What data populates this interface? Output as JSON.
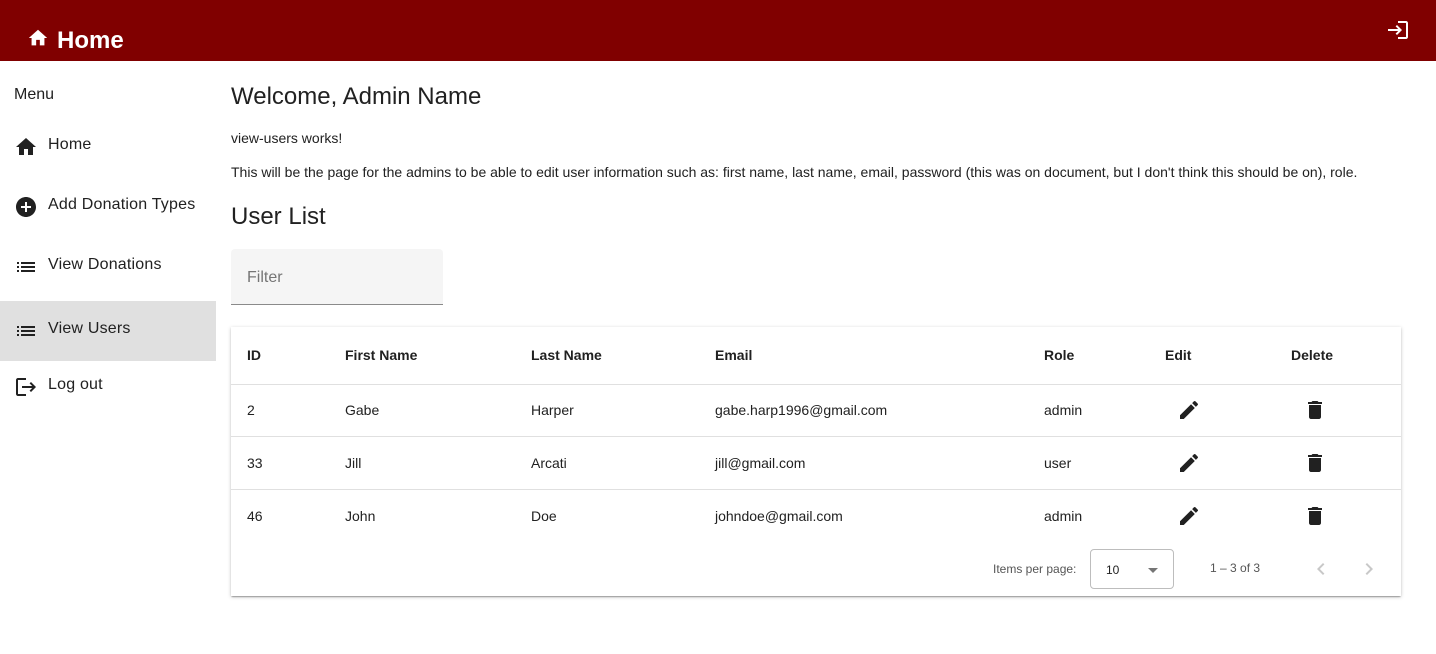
{
  "header": {
    "title": "Home",
    "home_icon": "home-icon",
    "login_icon": "login-icon",
    "color": "#800000"
  },
  "sidebar": {
    "title": "Menu",
    "items": [
      {
        "label": "Home",
        "icon": "home-icon",
        "active": false
      },
      {
        "label": "Add Donation Types",
        "icon": "add-circle-icon",
        "active": false
      },
      {
        "label": "View Donations",
        "icon": "list-icon",
        "active": false
      },
      {
        "label": "View Users",
        "icon": "list-icon",
        "active": true
      },
      {
        "label": "Log out",
        "icon": "logout-icon",
        "active": false
      }
    ]
  },
  "main": {
    "welcome": "Welcome, Admin Name",
    "p1": "view-users works!",
    "p2": "This will be the page for the admins to be able to edit user information such as: first name, last name, email, password (this was on document, but I don't think this should be on), role.",
    "user_list_title": "User List",
    "filter": {
      "placeholder": "Filter",
      "value": ""
    }
  },
  "table": {
    "columns": [
      "ID",
      "First Name",
      "Last Name",
      "Email",
      "Role",
      "Edit",
      "Delete"
    ],
    "rows": [
      {
        "id": "2",
        "first": "Gabe",
        "last": "Harper",
        "email": "gabe.harp1996@gmail.com",
        "role": "admin"
      },
      {
        "id": "33",
        "first": "Jill",
        "last": "Arcati",
        "email": "jill@gmail.com",
        "role": "user"
      },
      {
        "id": "46",
        "first": "John",
        "last": "Doe",
        "email": "johndoe@gmail.com",
        "role": "admin"
      }
    ]
  },
  "paginator": {
    "items_per_page_label": "Items per page:",
    "items_per_page": "10",
    "range": "1 – 3 of 3"
  }
}
